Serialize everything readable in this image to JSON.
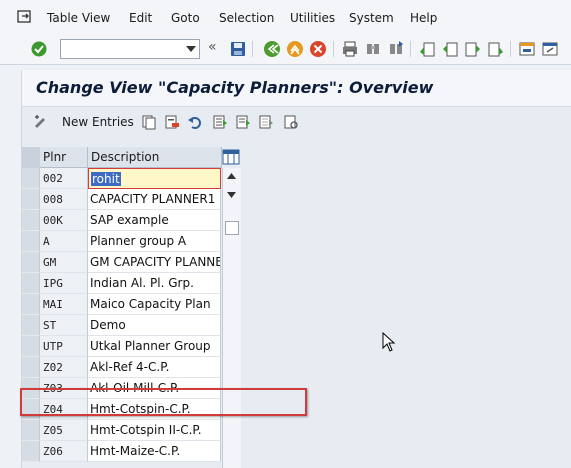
{
  "menu": {
    "items": [
      "Table View",
      "Edit",
      "Goto",
      "Selection",
      "Utilities",
      "System",
      "Help"
    ],
    "icon": "menu-square-icon"
  },
  "toolbar": {
    "command_field_value": "",
    "icons": [
      "enter-check-icon",
      "save-icon",
      "back-icon",
      "exit-icon",
      "cancel-icon",
      "print-icon",
      "find-icon",
      "find-next-icon",
      "first-page-icon",
      "previous-page-icon",
      "next-page-icon",
      "last-page-icon",
      "create-session-icon",
      "shortcut-icon"
    ]
  },
  "page": {
    "title": "Change View \"Capacity Planners\": Overview",
    "new_entries_label": "New Entries"
  },
  "table": {
    "columns": [
      "Plnr",
      "Description"
    ],
    "rows": [
      {
        "code": "002",
        "description": "rohit"
      },
      {
        "code": "008",
        "description": "CAPACITY PLANNER1"
      },
      {
        "code": "00K",
        "description": "SAP example"
      },
      {
        "code": "A",
        "description": "Planner group A"
      },
      {
        "code": "GM",
        "description": "GM CAPACITY PLANNER"
      },
      {
        "code": "IPG",
        "description": "Indian Al. Pl. Grp."
      },
      {
        "code": "MAI",
        "description": "Maico Capacity Plan"
      },
      {
        "code": "ST",
        "description": "Demo"
      },
      {
        "code": "UTP",
        "description": "Utkal Planner Group"
      },
      {
        "code": "Z02",
        "description": "Akl-Ref 4-C.P."
      },
      {
        "code": "Z03",
        "description": "Akl-Oil Mill-C.P."
      },
      {
        "code": "Z04",
        "description": "Hmt-Cotspin-C.P."
      },
      {
        "code": "Z05",
        "description": "Hmt-Cotspin II-C.P."
      },
      {
        "code": "Z06",
        "description": "Hmt-Maize-C.P."
      }
    ],
    "highlighted_row": "ST"
  },
  "colors": {
    "highlight_border": "#d33a3a",
    "title_text": "#0c1d3a",
    "selected_text_bg": "#3e6cc4"
  }
}
